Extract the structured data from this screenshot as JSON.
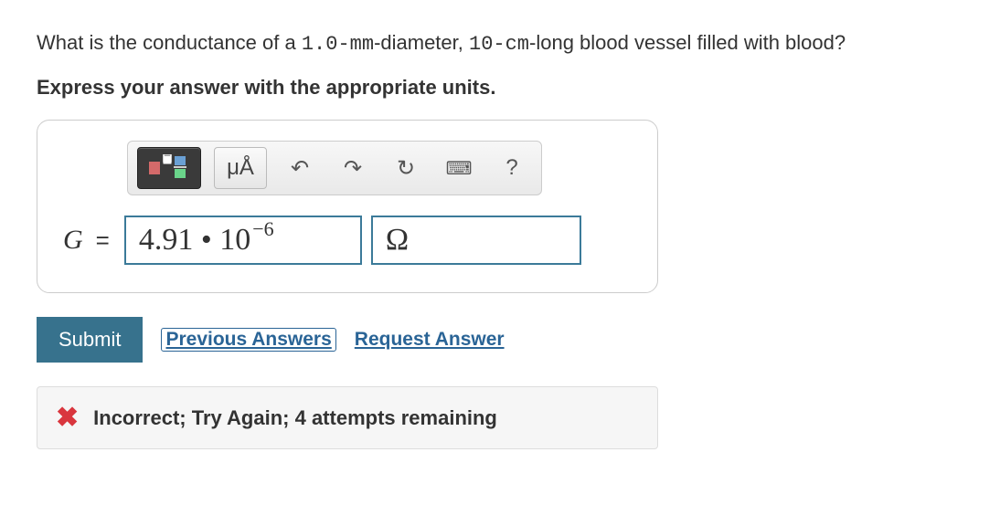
{
  "question": {
    "prefix": "What is the conductance of a ",
    "dim1": "1.0-mm",
    "mid1": "-diameter, ",
    "dim2": "10-cm",
    "suffix": "-long blood vessel filled with blood?"
  },
  "instruction": "Express your answer with the appropriate units.",
  "toolbar": {
    "units_label": "μÅ",
    "undo_glyph": "↶",
    "redo_glyph": "↷",
    "reset_glyph": "↻",
    "keyboard_glyph": "⌨",
    "help_glyph": "?"
  },
  "answer": {
    "variable": "G",
    "equals": "=",
    "value_mantissa": "4.91 • 10",
    "value_exponent": "−6",
    "unit": "Ω"
  },
  "actions": {
    "submit": "Submit",
    "previous": "Previous Answers",
    "request": "Request Answer"
  },
  "feedback": {
    "icon": "✖",
    "text": "Incorrect; Try Again; 4 attempts remaining"
  }
}
